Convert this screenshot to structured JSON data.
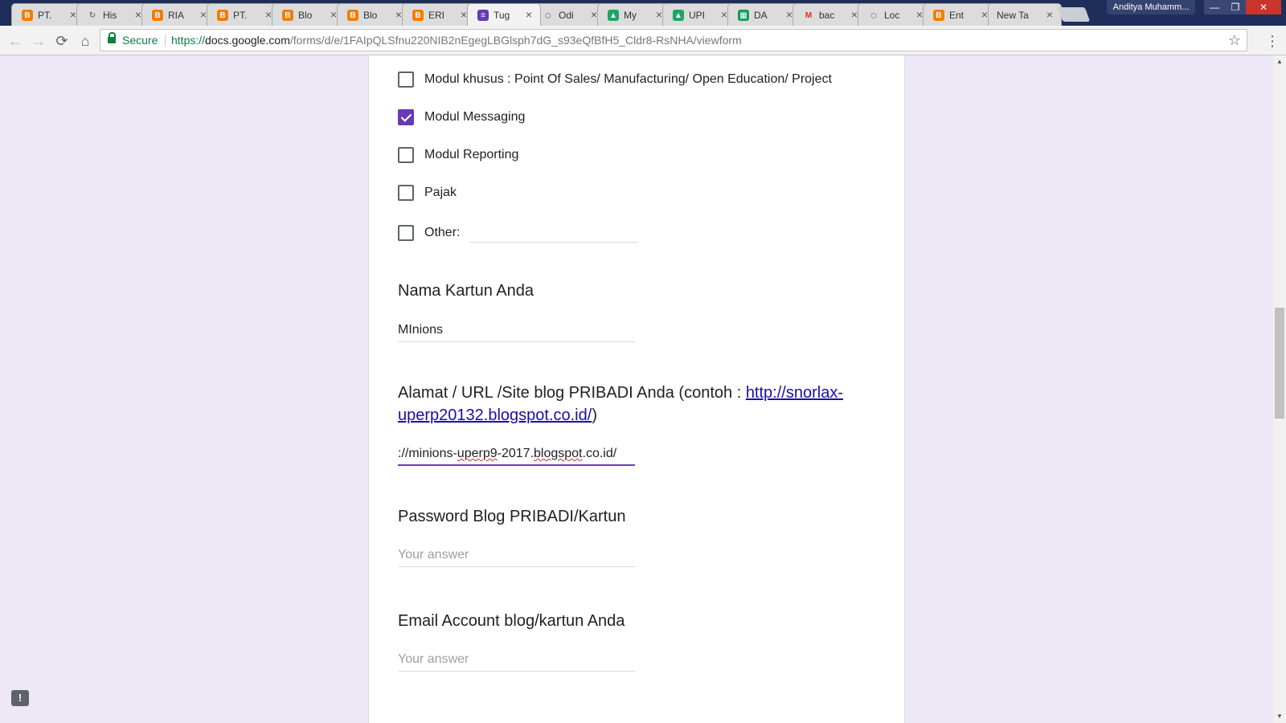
{
  "browser": {
    "tabs": [
      {
        "label": "PT.",
        "favicon": "blogger-icon",
        "color": "#f57c00"
      },
      {
        "label": "His",
        "favicon": "history-icon",
        "color": "#777777"
      },
      {
        "label": "RIA",
        "favicon": "blogger-icon",
        "color": "#f57c00"
      },
      {
        "label": "PT.",
        "favicon": "blogger-icon",
        "color": "#f57c00"
      },
      {
        "label": "Blo",
        "favicon": "blogger-icon",
        "color": "#f57c00"
      },
      {
        "label": "Blo",
        "favicon": "blogger-icon",
        "color": "#f57c00"
      },
      {
        "label": "ERI",
        "favicon": "blogger-icon",
        "color": "#f57c00"
      },
      {
        "label": "Tug",
        "favicon": "forms-icon",
        "color": "#673ab7",
        "active": true
      },
      {
        "label": "Odi",
        "favicon": "circle-icon",
        "color": "#a052b5"
      },
      {
        "label": "My",
        "favicon": "drive-icon",
        "color": "#1fa463"
      },
      {
        "label": "UPI",
        "favicon": "drive-icon",
        "color": "#1fa463"
      },
      {
        "label": "DA",
        "favicon": "sheets-icon",
        "color": "#0f9d58"
      },
      {
        "label": "bac",
        "favicon": "gmail-icon",
        "color": "#d93025"
      },
      {
        "label": "Loc",
        "favicon": "circle-icon",
        "color": "#a052b5"
      },
      {
        "label": "Ent",
        "favicon": "blogger-icon",
        "color": "#f57c00"
      },
      {
        "label": "New Ta",
        "favicon": "",
        "color": ""
      }
    ],
    "profile_name": "Anditya Muhamm...",
    "secure_label": "Secure",
    "url_scheme": "https://",
    "url_host": "docs.google.com",
    "url_path": "/forms/d/e/1FAIpQLSfnu220NIB2nEgegLBGlsph7dG_s93eQfBfH5_Cldr8-RsNHA/viewform"
  },
  "form": {
    "options": [
      {
        "label": "Modul khusus : Point Of Sales/ Manufacturing/ Open Education/ Project",
        "checked": false
      },
      {
        "label": "Modul Messaging",
        "checked": true
      },
      {
        "label": "Modul Reporting",
        "checked": false
      },
      {
        "label": "Pajak",
        "checked": false
      }
    ],
    "other_label": "Other:",
    "q_nama": {
      "title": "Nama Kartun Anda",
      "value": "MInions"
    },
    "q_alamat": {
      "title_prefix": "Alamat / URL /Site blog PRIBADI Anda (contoh : ",
      "link_text": "http://snorlax-uperp20132.blogspot.co.id/",
      "title_suffix": ")",
      "value_a": "://minions-",
      "value_b": "uperp9",
      "value_c": "-2017.",
      "value_d": "blogspot",
      "value_e": ".co.id/"
    },
    "q_password": {
      "title": "Password Blog PRIBADI/Kartun",
      "placeholder": "Your answer"
    },
    "q_email": {
      "title": "Email Account blog/kartun Anda",
      "placeholder": "Your answer"
    }
  },
  "colors": {
    "accent": "#673ab7",
    "page_bg": "#ede7f6",
    "tabstrip": "#1f2d5b"
  }
}
